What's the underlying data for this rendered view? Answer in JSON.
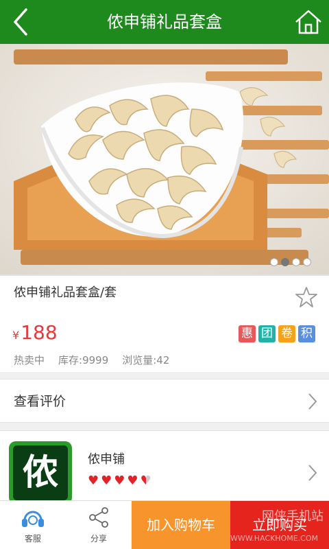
{
  "header": {
    "title": "侬申铺礼品套盒"
  },
  "hero": {
    "slide_count": 4,
    "active_slide": 2
  },
  "product": {
    "name": "侬申铺礼品套盒/套",
    "currency": "¥",
    "price": "188",
    "badges": [
      {
        "label": "惠",
        "color": "#e8585a"
      },
      {
        "label": "团",
        "color": "#22b3a8"
      },
      {
        "label": "卷",
        "color": "#f4a219"
      },
      {
        "label": "积",
        "color": "#5a8fe0"
      }
    ],
    "status": "热卖中",
    "stock": "库存:9999",
    "views": "浏览量:42"
  },
  "review": {
    "label": "查看评价"
  },
  "store": {
    "logo_char": "侬",
    "name": "侬申铺",
    "rating": 4.5,
    "rating_max": 5
  },
  "bottom_bar": {
    "service_label": "客服",
    "share_label": "分享",
    "cart_label": "加入购物车",
    "buy_label": "立即购买"
  },
  "watermark": {
    "text": "网侠手机站",
    "url": "WWW.HACKHOME.COM"
  },
  "colors": {
    "brand_green": "#1e8a1e",
    "price_red": "#e43a3a",
    "cart_orange": "#f7942b",
    "buy_red": "#e5251d"
  }
}
